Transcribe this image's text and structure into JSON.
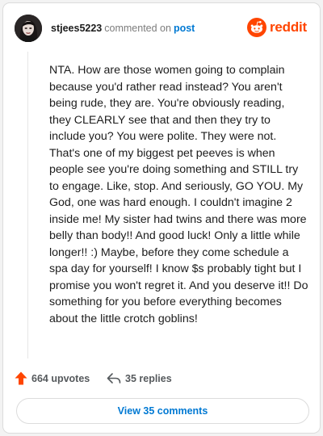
{
  "comment": {
    "username": "stjees5223",
    "action_text": "commented on",
    "post_link_label": "post",
    "body": "NTA. How are those women going to complain because you'd rather read instead? You aren't being rude, they are. You're obviously reading, they CLEARLY see that and then they try to include you? You were polite. They were not. That's one of my biggest pet peeves is when people see you're doing something and STILL try to engage. Like, stop. And seriously, GO YOU. My God, one was hard enough. I couldn't imagine 2 inside me! My sister had twins and there was more belly than body!! And good luck! Only a little while longer!! :) Maybe, before they come schedule a spa day for yourself! I know $s probably tight but I promise you won't regret it. And you deserve it!! Do something for you before everything becomes about the little crotch goblins!",
    "upvotes_label": "664 upvotes",
    "replies_label": "35 replies",
    "view_comments_label": "View 35 comments"
  },
  "brand": {
    "name": "reddit",
    "icon": "reddit-snoo-icon"
  },
  "colors": {
    "brand_orange": "#ff4500",
    "link_blue": "#0079d3",
    "text_dark": "#1c1c1c",
    "text_muted": "#7c7c7c"
  }
}
